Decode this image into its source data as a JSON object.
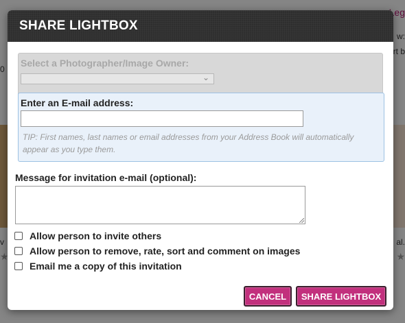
{
  "background": {
    "top_right_link": "Leg",
    "row1_text": "w:",
    "row2_text": "rt b",
    "left_text": "0",
    "caption_left": "v",
    "caption_right": "al.",
    "stars_left": "★",
    "stars_right": "★"
  },
  "dialog": {
    "title": "SHARE LIGHTBOX",
    "owner": {
      "label": "Select a Photographer/Image Owner:",
      "selected": ""
    },
    "email": {
      "label": "Enter an E-mail address:",
      "value": "",
      "tip": "TIP: First names, last names or email addresses from your Address Book will automatically appear as you type them."
    },
    "message": {
      "label": "Message for invitation e-mail (optional):",
      "value": ""
    },
    "options": [
      {
        "label": "Allow person to invite others",
        "checked": false
      },
      {
        "label": "Allow person to remove, rate, sort and comment on images",
        "checked": false
      },
      {
        "label": "Email me a copy of this invitation",
        "checked": false
      }
    ],
    "buttons": {
      "cancel": "CANCEL",
      "share": "SHARE LIGHTBOX"
    }
  },
  "colors": {
    "header_bg": "#2e2e2e",
    "button_bg": "#c2307d",
    "email_section_bg": "#e9f1fa",
    "owner_section_bg": "#d8d8d8"
  }
}
